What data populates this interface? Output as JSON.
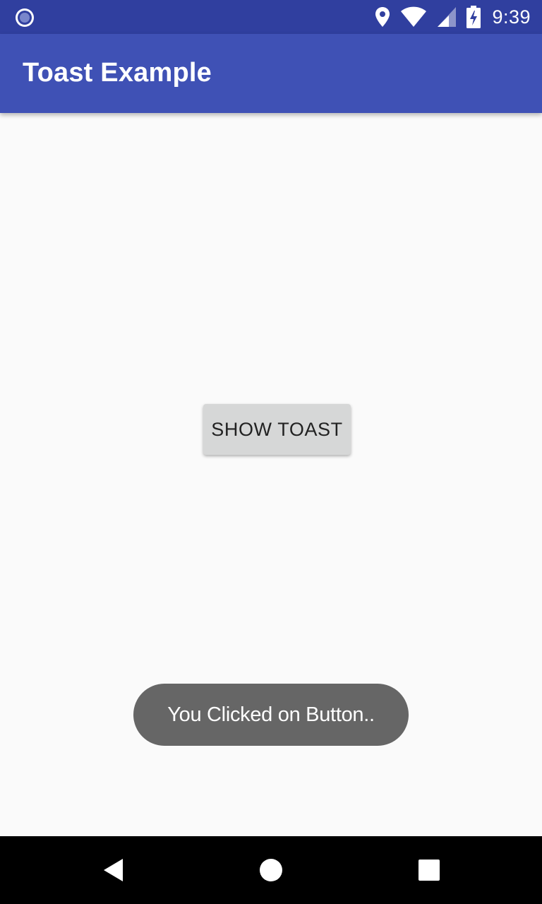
{
  "status_bar": {
    "time": "9:39",
    "left_icon": "notification-circle-icon",
    "icons": [
      "location-icon",
      "wifi-icon",
      "cell-signal-icon",
      "battery-charging-icon"
    ]
  },
  "app_bar": {
    "title": "Toast Example"
  },
  "main": {
    "button_label": "SHOW TOAST"
  },
  "toast": {
    "message": "You Clicked on Button.."
  },
  "nav_bar": {
    "buttons": [
      "back-icon",
      "home-icon",
      "recents-icon"
    ]
  },
  "colors": {
    "status_bar": "#303f9f",
    "app_bar": "#3f51b5",
    "background": "#fafafa",
    "button": "#d6d7d7",
    "toast": "#666666",
    "nav_bar": "#000000"
  }
}
